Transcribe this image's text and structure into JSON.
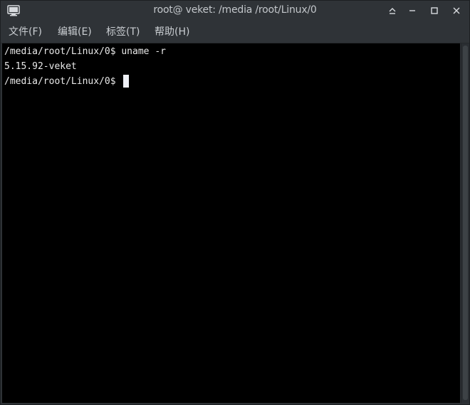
{
  "window": {
    "title": "root@ veket: /media /root/Linux/0",
    "icon": "terminal-icon",
    "controls": {
      "shade": "⩯",
      "minimize": "—",
      "maximize": "☐",
      "close": "✕"
    }
  },
  "menu": {
    "items": [
      {
        "label": "文件(F)"
      },
      {
        "label": "编辑(E)"
      },
      {
        "label": "标签(T)"
      },
      {
        "label": "帮助(H)"
      }
    ]
  },
  "terminal": {
    "lines": [
      "/media/root/Linux/0$ uname -r",
      "5.15.92-veket",
      "/media/root/Linux/0$ "
    ],
    "colors": {
      "background": "#000000",
      "foreground": "#e8e8e8",
      "cursor": "#eef0f6"
    }
  }
}
